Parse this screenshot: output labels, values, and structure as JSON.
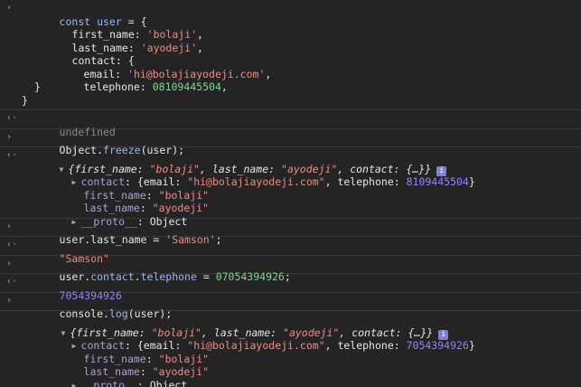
{
  "colors": {
    "background": "#242424",
    "string": "#f28b82",
    "number": "#9980ff",
    "keyword": "#9cb8f0"
  },
  "e1": {
    "l1": {
      "a": "const ",
      "b": "user",
      "c": " = {"
    },
    "l2": {
      "k": "first_name",
      "s": "'bolaji'",
      "t": ","
    },
    "l3": {
      "k": "last_name",
      "s": "'ayodeji'",
      "t": ","
    },
    "l4": {
      "k": "contact",
      "t": ": {"
    },
    "l5": {
      "k": "email",
      "s": "'hi@bolajiayodeji.com'",
      "t": ","
    },
    "l6": {
      "k": "telephone",
      "n": "08109445504",
      "t": ","
    },
    "l7": "}",
    "l8": "}"
  },
  "e2": {
    "text": "undefined"
  },
  "e3": {
    "a": "Object",
    "b": ".",
    "c": "freeze",
    "d": "(user);"
  },
  "e4": {
    "summary": {
      "p1": "{",
      "k1": "first_name",
      "v1": "\"bolaji\"",
      "k2": "last_name",
      "v2": "\"ayodeji\"",
      "k3": "contact",
      "v3": "{…}",
      "p2": "}"
    },
    "contact": {
      "k": "contact",
      "a": "{email: ",
      "s": "\"hi@bolajiayodeji.com\"",
      "b": ", telephone: ",
      "n": "8109445504",
      "c": "}"
    },
    "first": {
      "k": "first_name",
      "v": "\"bolaji\""
    },
    "last": {
      "k": "last_name",
      "v": "\"ayodeji\""
    },
    "proto": {
      "k": "__proto__",
      "v": "Object"
    }
  },
  "e5": {
    "a": "user",
    "b": ".last_name = ",
    "s": "'Samson'",
    "c": ";"
  },
  "e6": {
    "text": "\"Samson\""
  },
  "e7": {
    "a": "user",
    "b": ".",
    "c": "contact",
    "d": ".",
    "e": "telephone",
    "f": " = ",
    "n": "07054394926",
    "g": ";"
  },
  "e8": {
    "text": "7054394926"
  },
  "e9": {
    "a": "console",
    "b": ".",
    "c": "log",
    "d": "(user);"
  },
  "e10": {
    "summary": {
      "p1": "{",
      "k1": "first_name",
      "v1": "\"bolaji\"",
      "k2": "last_name",
      "v2": "\"ayodeji\"",
      "k3": "contact",
      "v3": "{…}",
      "p2": "}"
    },
    "contact": {
      "k": "contact",
      "a": "{email: ",
      "s": "\"hi@bolajiayodeji.com\"",
      "b": ", telephone: ",
      "n": "7054394926",
      "c": "}"
    },
    "first": {
      "k": "first_name",
      "v": "\"bolaji\""
    },
    "last": {
      "k": "last_name",
      "v": "\"ayodeji\""
    },
    "proto": {
      "k": "__proto__",
      "v": "Object"
    }
  },
  "icons": {
    "input": "chevron-right-icon",
    "output": "return-arrow-icon",
    "expand": "triangle-icon",
    "info": "info-icon"
  },
  "glyphs": {
    "input": "›",
    "output": "‹·",
    "down": "▼",
    "right": "▶",
    "info": "i"
  }
}
